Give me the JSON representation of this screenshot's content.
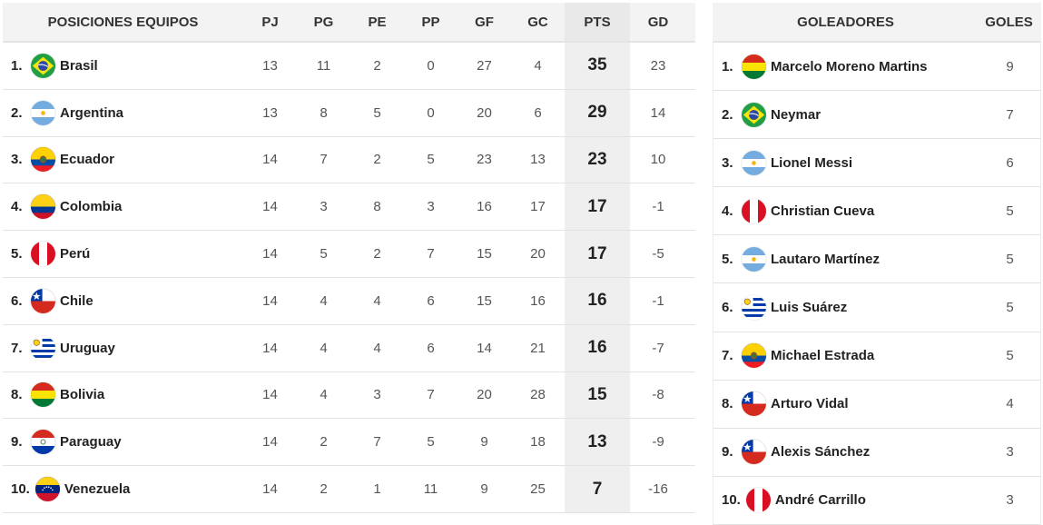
{
  "standings": {
    "headers": {
      "team": "POSICIONES EQUIPOS",
      "pj": "PJ",
      "pg": "PG",
      "pe": "PE",
      "pp": "PP",
      "gf": "GF",
      "gc": "GC",
      "pts": "PTS",
      "gd": "GD"
    },
    "rows": [
      {
        "pos": "1.",
        "team": "Brasil",
        "flag": "brazil-flag-icon",
        "pj": "13",
        "pg": "11",
        "pe": "2",
        "pp": "0",
        "gf": "27",
        "gc": "4",
        "pts": "35",
        "gd": "23"
      },
      {
        "pos": "2.",
        "team": "Argentina",
        "flag": "argentina-flag-icon",
        "pj": "13",
        "pg": "8",
        "pe": "5",
        "pp": "0",
        "gf": "20",
        "gc": "6",
        "pts": "29",
        "gd": "14"
      },
      {
        "pos": "3.",
        "team": "Ecuador",
        "flag": "ecuador-flag-icon",
        "pj": "14",
        "pg": "7",
        "pe": "2",
        "pp": "5",
        "gf": "23",
        "gc": "13",
        "pts": "23",
        "gd": "10"
      },
      {
        "pos": "4.",
        "team": "Colombia",
        "flag": "colombia-flag-icon",
        "pj": "14",
        "pg": "3",
        "pe": "8",
        "pp": "3",
        "gf": "16",
        "gc": "17",
        "pts": "17",
        "gd": "-1"
      },
      {
        "pos": "5.",
        "team": "Perú",
        "flag": "peru-flag-icon",
        "pj": "14",
        "pg": "5",
        "pe": "2",
        "pp": "7",
        "gf": "15",
        "gc": "20",
        "pts": "17",
        "gd": "-5"
      },
      {
        "pos": "6.",
        "team": "Chile",
        "flag": "chile-flag-icon",
        "pj": "14",
        "pg": "4",
        "pe": "4",
        "pp": "6",
        "gf": "15",
        "gc": "16",
        "pts": "16",
        "gd": "-1"
      },
      {
        "pos": "7.",
        "team": "Uruguay",
        "flag": "uruguay-flag-icon",
        "pj": "14",
        "pg": "4",
        "pe": "4",
        "pp": "6",
        "gf": "14",
        "gc": "21",
        "pts": "16",
        "gd": "-7"
      },
      {
        "pos": "8.",
        "team": "Bolivia",
        "flag": "bolivia-flag-icon",
        "pj": "14",
        "pg": "4",
        "pe": "3",
        "pp": "7",
        "gf": "20",
        "gc": "28",
        "pts": "15",
        "gd": "-8"
      },
      {
        "pos": "9.",
        "team": "Paraguay",
        "flag": "paraguay-flag-icon",
        "pj": "14",
        "pg": "2",
        "pe": "7",
        "pp": "5",
        "gf": "9",
        "gc": "18",
        "pts": "13",
        "gd": "-9"
      },
      {
        "pos": "10.",
        "team": "Venezuela",
        "flag": "venezuela-flag-icon",
        "pj": "14",
        "pg": "2",
        "pe": "1",
        "pp": "11",
        "gf": "9",
        "gc": "25",
        "pts": "7",
        "gd": "-16"
      }
    ]
  },
  "scorers": {
    "headers": {
      "name": "GOLEADORES",
      "goals": "GOLES"
    },
    "rows": [
      {
        "pos": "1.",
        "name": "Marcelo Moreno Martins",
        "flag": "bolivia-flag-icon",
        "goals": "9"
      },
      {
        "pos": "2.",
        "name": "Neymar",
        "flag": "brazil-flag-icon",
        "goals": "7"
      },
      {
        "pos": "3.",
        "name": "Lionel Messi",
        "flag": "argentina-flag-icon",
        "goals": "6"
      },
      {
        "pos": "4.",
        "name": "Christian Cueva",
        "flag": "peru-flag-icon",
        "goals": "5"
      },
      {
        "pos": "5.",
        "name": "Lautaro Martínez",
        "flag": "argentina-flag-icon",
        "goals": "5"
      },
      {
        "pos": "6.",
        "name": "Luis Suárez",
        "flag": "uruguay-flag-icon",
        "goals": "5"
      },
      {
        "pos": "7.",
        "name": "Michael Estrada",
        "flag": "ecuador-flag-icon",
        "goals": "5"
      },
      {
        "pos": "8.",
        "name": "Arturo Vidal",
        "flag": "chile-flag-icon",
        "goals": "4"
      },
      {
        "pos": "9.",
        "name": "Alexis Sánchez",
        "flag": "chile-flag-icon",
        "goals": "3"
      },
      {
        "pos": "10.",
        "name": "André Carrillo",
        "flag": "peru-flag-icon",
        "goals": "3"
      }
    ]
  },
  "colors": {
    "header_bg": "#f3f3f3",
    "pts_column_bg": "#efefef",
    "row_border": "#e3e3e3"
  }
}
